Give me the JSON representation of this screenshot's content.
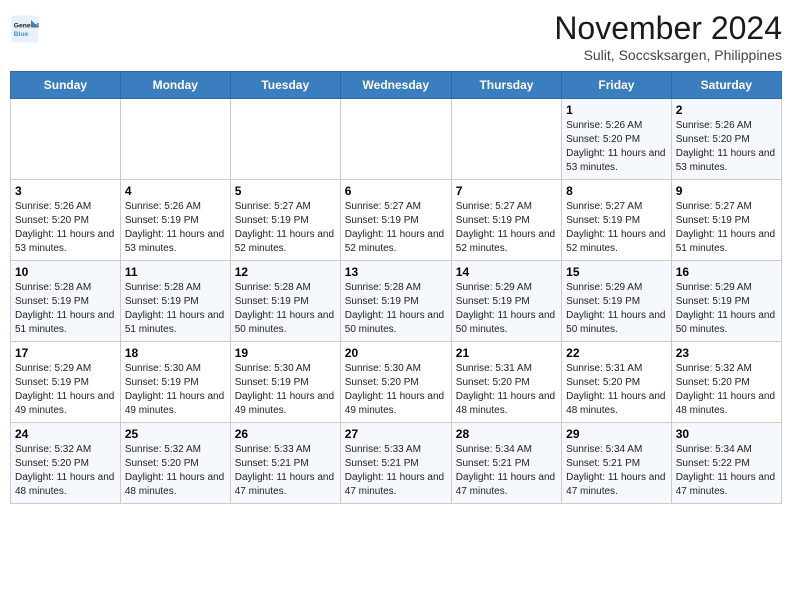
{
  "logo": {
    "line1": "General",
    "line2": "Blue"
  },
  "title": "November 2024",
  "location": "Sulit, Soccsksargen, Philippines",
  "days_of_week": [
    "Sunday",
    "Monday",
    "Tuesday",
    "Wednesday",
    "Thursday",
    "Friday",
    "Saturday"
  ],
  "weeks": [
    [
      {
        "day": "",
        "info": ""
      },
      {
        "day": "",
        "info": ""
      },
      {
        "day": "",
        "info": ""
      },
      {
        "day": "",
        "info": ""
      },
      {
        "day": "",
        "info": ""
      },
      {
        "day": "1",
        "info": "Sunrise: 5:26 AM\nSunset: 5:20 PM\nDaylight: 11 hours and 53 minutes."
      },
      {
        "day": "2",
        "info": "Sunrise: 5:26 AM\nSunset: 5:20 PM\nDaylight: 11 hours and 53 minutes."
      }
    ],
    [
      {
        "day": "3",
        "info": "Sunrise: 5:26 AM\nSunset: 5:20 PM\nDaylight: 11 hours and 53 minutes."
      },
      {
        "day": "4",
        "info": "Sunrise: 5:26 AM\nSunset: 5:19 PM\nDaylight: 11 hours and 53 minutes."
      },
      {
        "day": "5",
        "info": "Sunrise: 5:27 AM\nSunset: 5:19 PM\nDaylight: 11 hours and 52 minutes."
      },
      {
        "day": "6",
        "info": "Sunrise: 5:27 AM\nSunset: 5:19 PM\nDaylight: 11 hours and 52 minutes."
      },
      {
        "day": "7",
        "info": "Sunrise: 5:27 AM\nSunset: 5:19 PM\nDaylight: 11 hours and 52 minutes."
      },
      {
        "day": "8",
        "info": "Sunrise: 5:27 AM\nSunset: 5:19 PM\nDaylight: 11 hours and 52 minutes."
      },
      {
        "day": "9",
        "info": "Sunrise: 5:27 AM\nSunset: 5:19 PM\nDaylight: 11 hours and 51 minutes."
      }
    ],
    [
      {
        "day": "10",
        "info": "Sunrise: 5:28 AM\nSunset: 5:19 PM\nDaylight: 11 hours and 51 minutes."
      },
      {
        "day": "11",
        "info": "Sunrise: 5:28 AM\nSunset: 5:19 PM\nDaylight: 11 hours and 51 minutes."
      },
      {
        "day": "12",
        "info": "Sunrise: 5:28 AM\nSunset: 5:19 PM\nDaylight: 11 hours and 50 minutes."
      },
      {
        "day": "13",
        "info": "Sunrise: 5:28 AM\nSunset: 5:19 PM\nDaylight: 11 hours and 50 minutes."
      },
      {
        "day": "14",
        "info": "Sunrise: 5:29 AM\nSunset: 5:19 PM\nDaylight: 11 hours and 50 minutes."
      },
      {
        "day": "15",
        "info": "Sunrise: 5:29 AM\nSunset: 5:19 PM\nDaylight: 11 hours and 50 minutes."
      },
      {
        "day": "16",
        "info": "Sunrise: 5:29 AM\nSunset: 5:19 PM\nDaylight: 11 hours and 50 minutes."
      }
    ],
    [
      {
        "day": "17",
        "info": "Sunrise: 5:29 AM\nSunset: 5:19 PM\nDaylight: 11 hours and 49 minutes."
      },
      {
        "day": "18",
        "info": "Sunrise: 5:30 AM\nSunset: 5:19 PM\nDaylight: 11 hours and 49 minutes."
      },
      {
        "day": "19",
        "info": "Sunrise: 5:30 AM\nSunset: 5:19 PM\nDaylight: 11 hours and 49 minutes."
      },
      {
        "day": "20",
        "info": "Sunrise: 5:30 AM\nSunset: 5:20 PM\nDaylight: 11 hours and 49 minutes."
      },
      {
        "day": "21",
        "info": "Sunrise: 5:31 AM\nSunset: 5:20 PM\nDaylight: 11 hours and 48 minutes."
      },
      {
        "day": "22",
        "info": "Sunrise: 5:31 AM\nSunset: 5:20 PM\nDaylight: 11 hours and 48 minutes."
      },
      {
        "day": "23",
        "info": "Sunrise: 5:32 AM\nSunset: 5:20 PM\nDaylight: 11 hours and 48 minutes."
      }
    ],
    [
      {
        "day": "24",
        "info": "Sunrise: 5:32 AM\nSunset: 5:20 PM\nDaylight: 11 hours and 48 minutes."
      },
      {
        "day": "25",
        "info": "Sunrise: 5:32 AM\nSunset: 5:20 PM\nDaylight: 11 hours and 48 minutes."
      },
      {
        "day": "26",
        "info": "Sunrise: 5:33 AM\nSunset: 5:21 PM\nDaylight: 11 hours and 47 minutes."
      },
      {
        "day": "27",
        "info": "Sunrise: 5:33 AM\nSunset: 5:21 PM\nDaylight: 11 hours and 47 minutes."
      },
      {
        "day": "28",
        "info": "Sunrise: 5:34 AM\nSunset: 5:21 PM\nDaylight: 11 hours and 47 minutes."
      },
      {
        "day": "29",
        "info": "Sunrise: 5:34 AM\nSunset: 5:21 PM\nDaylight: 11 hours and 47 minutes."
      },
      {
        "day": "30",
        "info": "Sunrise: 5:34 AM\nSunset: 5:22 PM\nDaylight: 11 hours and 47 minutes."
      }
    ]
  ]
}
